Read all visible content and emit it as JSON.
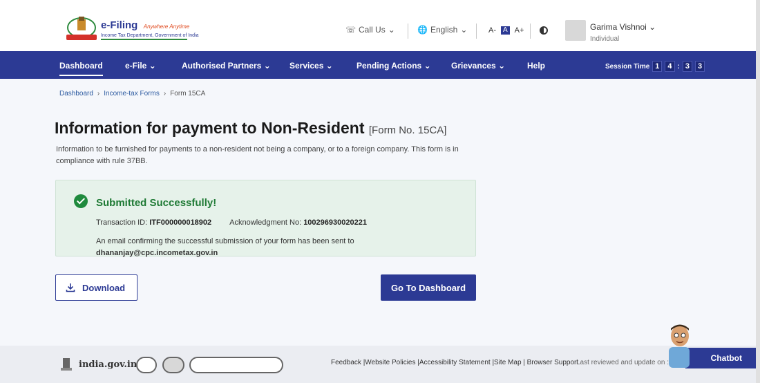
{
  "brand": {
    "title": "e-Filing",
    "tagline": "Anywhere Anytime",
    "subtitle": "Income Tax Department, Government of India"
  },
  "header": {
    "call_us": "Call Us",
    "language": "English",
    "font_small": "A-",
    "font_normal": "A",
    "font_large": "A+",
    "user_name": "Garima Vishnoi",
    "user_role": "Individual"
  },
  "nav": {
    "items": [
      "Dashboard",
      "e-File",
      "Authorised Partners",
      "Services",
      "Pending Actions",
      "Grievances",
      "Help"
    ],
    "session_label": "Session Time",
    "session_digits": [
      "1",
      "4",
      "3",
      "3"
    ]
  },
  "breadcrumb": [
    "Dashboard",
    "Income-tax Forms",
    "Form 15CA"
  ],
  "page": {
    "title": "Information for payment to Non-Resident",
    "form_no": "[Form No. 15CA]",
    "description": "Information to be furnished for payments to a non-resident not being a company, or to a foreign company. This form is in compliance with rule 37BB."
  },
  "success": {
    "title": "Submitted Successfully!",
    "transaction_label": "Transaction ID:",
    "transaction_id": "ITF000000018902",
    "ack_label": "Acknowledgment No:",
    "ack_no": "100296930020221",
    "email_text": "An email confirming the successful submission of your form has been sent to",
    "email": "dhananjay@cpc.incometax.gov.in"
  },
  "buttons": {
    "download": "Download",
    "dashboard": "Go To Dashboard"
  },
  "footer": {
    "site": "india.gov.in",
    "links": "Feedback |Website Policies |Accessibility Statement |Site Map | Browser Support",
    "last_reviewed": "Last reviewed and update on :",
    "chatbot": "Chatbot"
  },
  "colors": {
    "primary": "#2c3a94",
    "success": "#1f8a3d",
    "success_bg": "#e6f2ea"
  }
}
